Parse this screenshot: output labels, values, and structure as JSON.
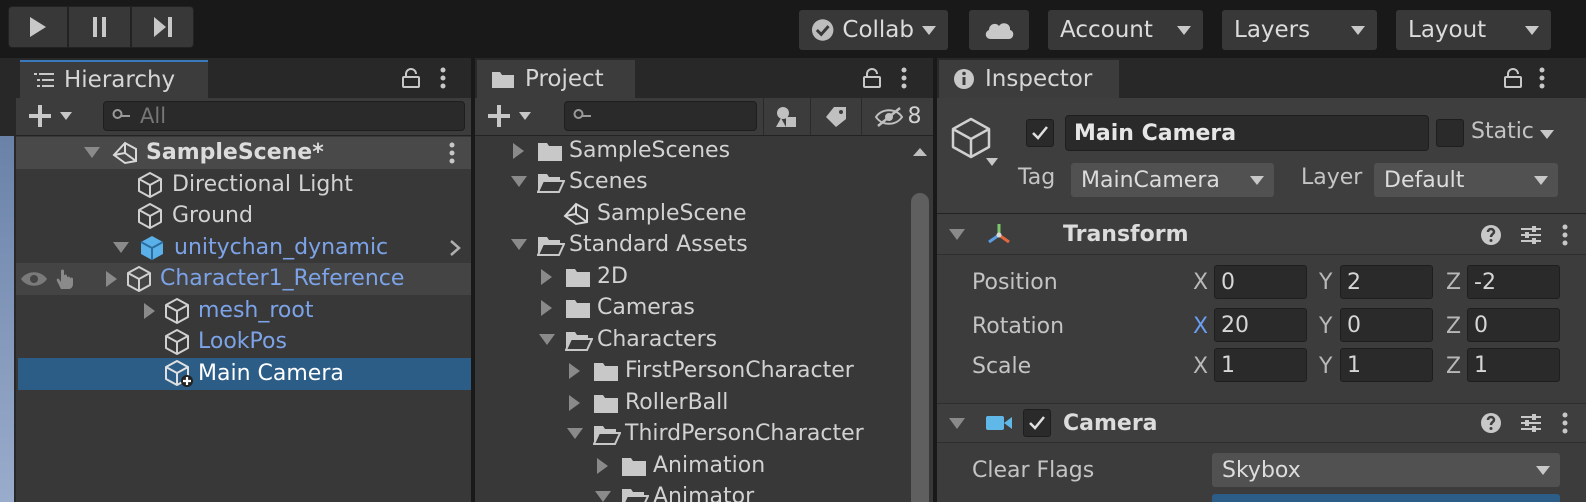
{
  "toolbar": {
    "collab": "Collab",
    "account": "Account",
    "layers": "Layers",
    "layout": "Layout"
  },
  "hierarchy": {
    "tab": "Hierarchy",
    "search_placeholder": "All",
    "scene": "SampleScene*",
    "items": [
      {
        "label": "Directional Light"
      },
      {
        "label": "Ground"
      },
      {
        "label": "unitychan_dynamic"
      },
      {
        "label": "Character1_Reference"
      },
      {
        "label": "mesh_root"
      },
      {
        "label": "LookPos"
      },
      {
        "label": "Main Camera"
      }
    ]
  },
  "project": {
    "tab": "Project",
    "hidden_count": "8",
    "items": [
      {
        "label": "SampleScenes"
      },
      {
        "label": "Scenes"
      },
      {
        "label": "SampleScene"
      },
      {
        "label": "Standard Assets"
      },
      {
        "label": "2D"
      },
      {
        "label": "Cameras"
      },
      {
        "label": "Characters"
      },
      {
        "label": "FirstPersonCharacter"
      },
      {
        "label": "RollerBall"
      },
      {
        "label": "ThirdPersonCharacter"
      },
      {
        "label": "Animation"
      },
      {
        "label": "Animator"
      }
    ]
  },
  "inspector": {
    "tab": "Inspector",
    "object_name": "Main Camera",
    "static_label": "Static",
    "tag_label": "Tag",
    "tag_value": "MainCamera",
    "layer_label": "Layer",
    "layer_value": "Default",
    "transform": {
      "title": "Transform",
      "position_label": "Position",
      "rotation_label": "Rotation",
      "scale_label": "Scale",
      "x": "X",
      "y": "Y",
      "z": "Z",
      "position": [
        "0",
        "2",
        "-2"
      ],
      "rotation": [
        "20",
        "0",
        "0"
      ],
      "scale": [
        "1",
        "1",
        "1"
      ]
    },
    "camera": {
      "title": "Camera",
      "clear_flags_label": "Clear Flags",
      "clear_flags_value": "Skybox"
    }
  },
  "colors": {
    "selection": "#2c5d87",
    "prefab_blue": "#7ca3e8",
    "panel": "#383838"
  }
}
